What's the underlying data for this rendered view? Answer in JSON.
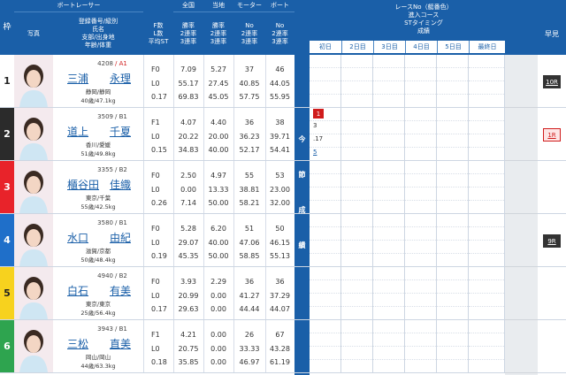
{
  "header": {
    "waku": "枠",
    "photo": "写真",
    "boatracer_title": "ボートレーサー",
    "racer_info": "登録番号/級別\n氏名\n支部/出身地\n年齢/体重",
    "f_l_st": "F数\nL数\n平均ST",
    "zenkoku_title": "全国",
    "zenkoku_cols": "勝率\n2連率\n3連率",
    "touchi_title": "当地",
    "touchi_cols": "勝率\n2連率\n3連率",
    "motor_title": "モーター",
    "motor_cols": "No\n2連率\n3連率",
    "boat_title": "ボート",
    "boat_cols": "No\n2連率\n3連率",
    "konsetu_info": "レースNo（艇番色）\n進入コース\nSTタイミング\n成績",
    "days": [
      "初日",
      "2日目",
      "3日目",
      "4日目",
      "5日目",
      "最終日"
    ],
    "hayami": "早見"
  },
  "konsetu_label": [
    "今",
    "節",
    "成",
    "績"
  ],
  "racers": [
    {
      "waku": "1",
      "reg": "4208",
      "cls": "A1",
      "name_last": "三浦",
      "name_first": "永理",
      "branch": "静岡/静岡",
      "age": "40歳/47.1kg",
      "f": "F0",
      "l": "L0",
      "st": "0.17",
      "z1": "7.09",
      "z2": "55.17",
      "z3": "69.83",
      "t1": "5.27",
      "t2": "27.45",
      "t3": "45.05",
      "m1": "37",
      "m2": "40.85",
      "m3": "57.75",
      "b1": "46",
      "b2": "44.05",
      "b3": "55.95",
      "hayami": "10R"
    },
    {
      "waku": "2",
      "reg": "3509",
      "cls": "B1",
      "name_last": "道上",
      "name_first": "千夏",
      "branch": "香川/愛媛",
      "age": "51歳/49.8kg",
      "f": "F1",
      "l": "L0",
      "st": "0.15",
      "z1": "4.07",
      "z2": "20.22",
      "z3": "34.83",
      "t1": "4.40",
      "t2": "20.00",
      "t3": "40.00",
      "m1": "36",
      "m2": "36.23",
      "m3": "52.17",
      "b1": "38",
      "b2": "39.71",
      "b3": "54.41",
      "hayami": "1R",
      "konsetu": {
        "race": "1",
        "course": "3",
        "st": ".17",
        "result": "5"
      }
    },
    {
      "waku": "3",
      "reg": "3355",
      "cls": "B2",
      "name_last": "櫃谷田",
      "name_first": "佳織",
      "branch": "東京/千葉",
      "age": "55歳/42.5kg",
      "f": "F0",
      "l": "L0",
      "st": "0.26",
      "z1": "2.50",
      "z2": "0.00",
      "z3": "7.14",
      "t1": "4.97",
      "t2": "13.33",
      "t3": "50.00",
      "m1": "55",
      "m2": "38.81",
      "m3": "58.21",
      "b1": "53",
      "b2": "23.00",
      "b3": "32.00",
      "hayami": ""
    },
    {
      "waku": "4",
      "reg": "3580",
      "cls": "B1",
      "name_last": "水口",
      "name_first": "由紀",
      "branch": "滋賀/京都",
      "age": "50歳/48.4kg",
      "f": "F0",
      "l": "L0",
      "st": "0.19",
      "z1": "5.28",
      "z2": "29.07",
      "z3": "45.35",
      "t1": "6.20",
      "t2": "40.00",
      "t3": "50.00",
      "m1": "51",
      "m2": "47.06",
      "m3": "58.85",
      "b1": "50",
      "b2": "46.15",
      "b3": "55.13",
      "hayami": "9R"
    },
    {
      "waku": "5",
      "reg": "4940",
      "cls": "B2",
      "name_last": "白石",
      "name_first": "有美",
      "branch": "東京/東京",
      "age": "25歳/56.4kg",
      "f": "F0",
      "l": "L0",
      "st": "0.17",
      "z1": "3.93",
      "z2": "20.99",
      "z3": "29.63",
      "t1": "2.29",
      "t2": "0.00",
      "t3": "0.00",
      "m1": "36",
      "m2": "41.27",
      "m3": "44.44",
      "b1": "36",
      "b2": "37.29",
      "b3": "44.07",
      "hayami": ""
    },
    {
      "waku": "6",
      "reg": "3943",
      "cls": "B1",
      "name_last": "三松",
      "name_first": "直美",
      "branch": "岡山/岡山",
      "age": "44歳/63.3kg",
      "f": "F1",
      "l": "L0",
      "st": "0.18",
      "z1": "4.21",
      "z2": "20.75",
      "z3": "35.85",
      "t1": "0.00",
      "t2": "0.00",
      "t3": "0.00",
      "m1": "26",
      "m2": "33.33",
      "m3": "46.97",
      "b1": "67",
      "b2": "43.28",
      "b3": "61.19",
      "hayami": ""
    }
  ],
  "colors": {
    "header_bg": "#1a5fa8",
    "waku": [
      {
        "bg": "#ffffff",
        "fg": "#222"
      },
      {
        "bg": "#2b2b2b",
        "fg": "#fff"
      },
      {
        "bg": "#e8232a",
        "fg": "#fff"
      },
      {
        "bg": "#1f6fc9",
        "fg": "#fff"
      },
      {
        "bg": "#f7d21e",
        "fg": "#222"
      },
      {
        "bg": "#2ea44f",
        "fg": "#fff"
      }
    ]
  }
}
